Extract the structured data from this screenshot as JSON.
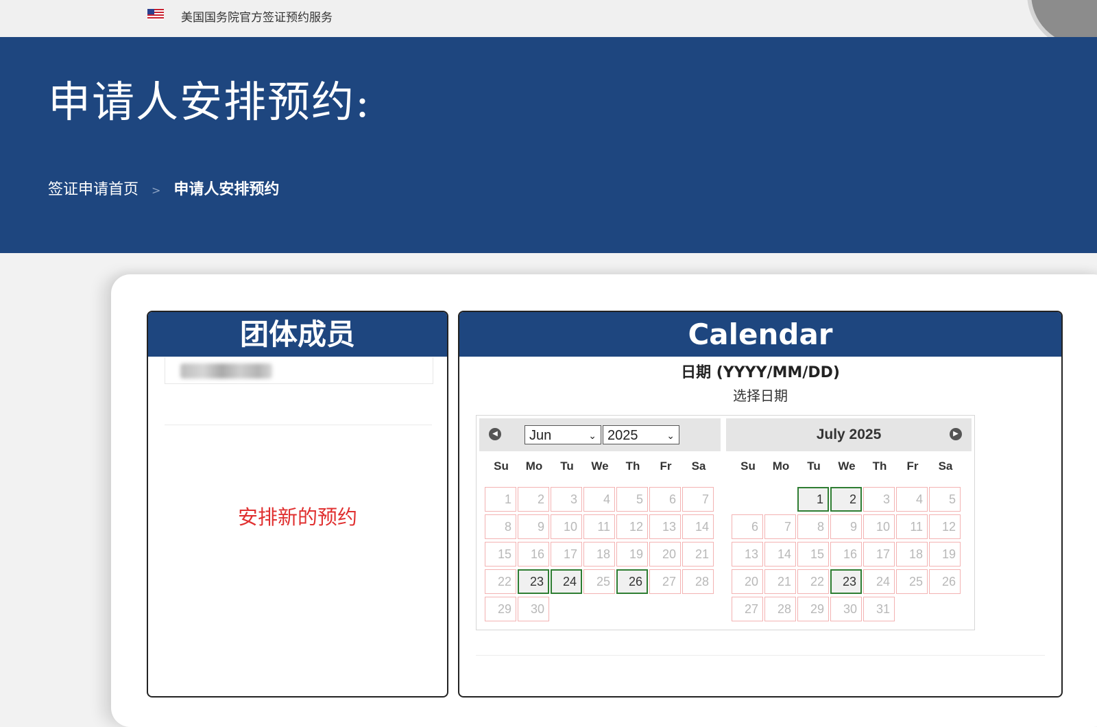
{
  "topbar": {
    "agency": "美国国务院官方签证预约服务",
    "flag_icon": "us-flag-icon"
  },
  "header": {
    "title": "申请人安排预约:"
  },
  "breadcrumb": {
    "home": "签证申请首页",
    "separator": ">",
    "current": "申请人安排预约"
  },
  "members_panel": {
    "title": "团体成员",
    "new_appointment": "安排新的预约"
  },
  "calendar_panel": {
    "title": "Calendar",
    "date_label": "日期 (YYYY/MM/DD)",
    "choose_date": "选择日期",
    "weekdays": [
      "Su",
      "Mo",
      "Tu",
      "We",
      "Th",
      "Fr",
      "Sa"
    ],
    "left_month": {
      "selected_month": "Jun",
      "selected_year": "2025",
      "first_weekday": 0,
      "days": 30,
      "available": [
        23,
        24,
        26
      ]
    },
    "right_month": {
      "title": "July 2025",
      "first_weekday": 2,
      "days": 31,
      "available": [
        1,
        2,
        23
      ]
    },
    "colors": {
      "header_blue": "#1e467f",
      "available_border": "#2e7d32",
      "unavailable_border": "#f3b2b2",
      "link_red": "#e03030"
    }
  }
}
